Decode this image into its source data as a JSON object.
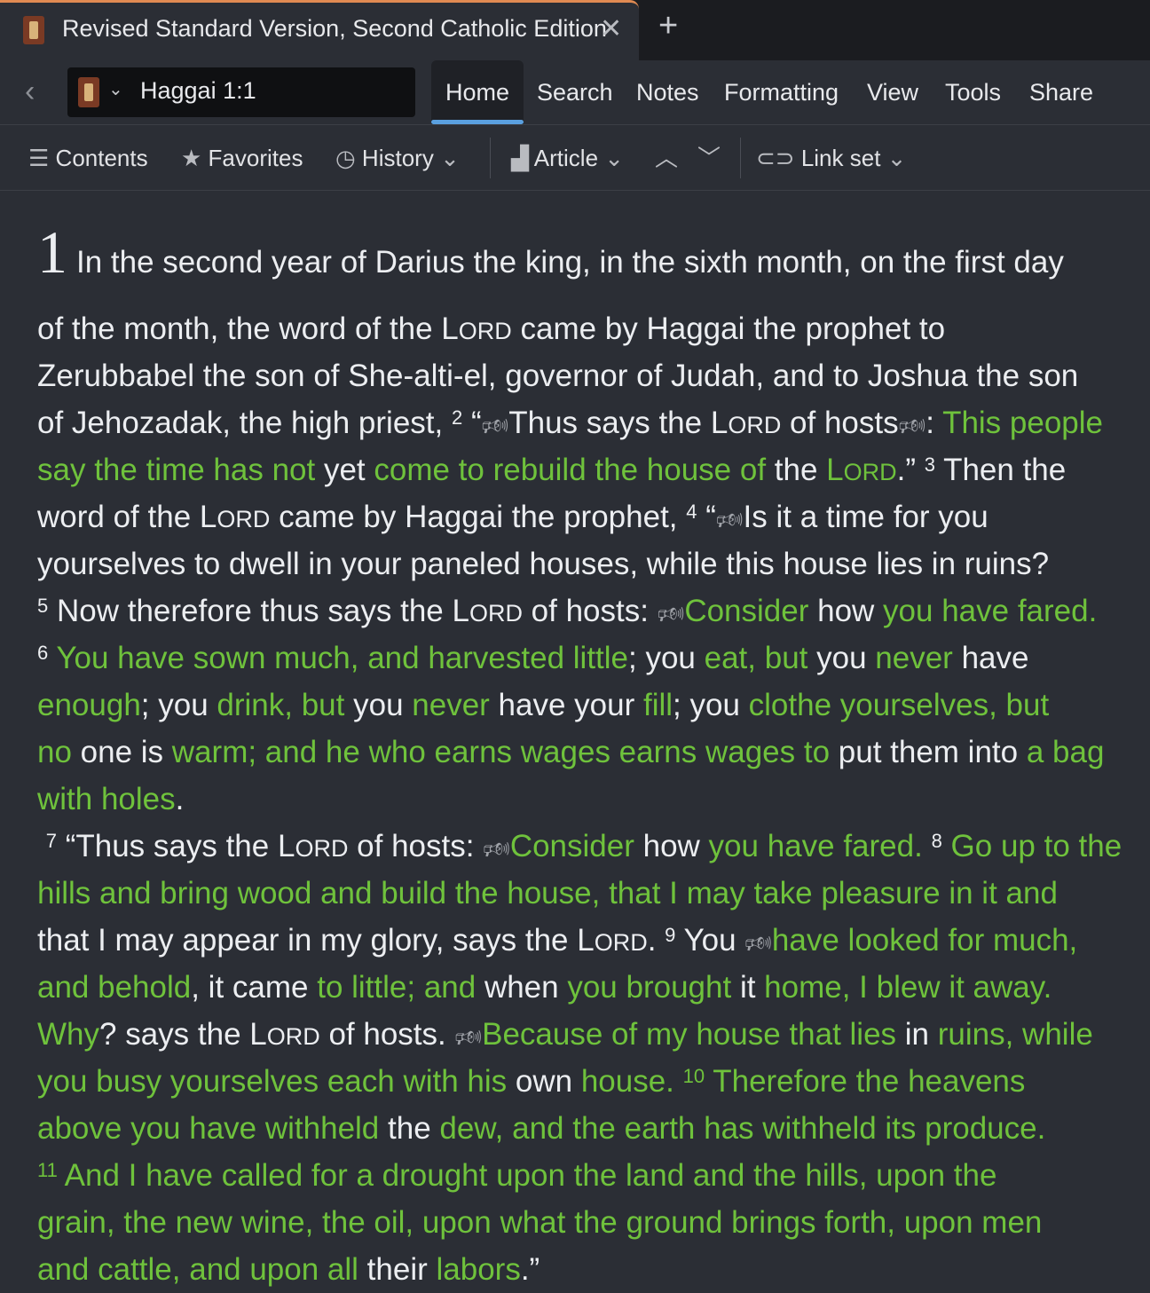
{
  "window": {
    "tab_title": "Revised Standard Version, Second Catholic Edition",
    "close_glyph": "✕",
    "add_glyph": "+"
  },
  "nav": {
    "back_glyph": "‹",
    "reference": "Haggai 1:1",
    "tabs": [
      {
        "label": "Home",
        "active": true
      },
      {
        "label": "Search"
      },
      {
        "label": "Notes"
      },
      {
        "label": "Formatting"
      },
      {
        "label": "View"
      },
      {
        "label": "Tools"
      },
      {
        "label": "Share"
      }
    ]
  },
  "toolbar": {
    "contents": "Contents",
    "favorites": "Favorites",
    "history": "History",
    "article": "Article",
    "link_set": "Link set"
  },
  "colors": {
    "background": "#2b2e35",
    "text": "#eceef1",
    "highlight_green": "#6fc23c",
    "tab_accent": "#5aa0e0",
    "tab_top_border": "#e08a52"
  },
  "text": {
    "chapter": "1",
    "marker": "🕬"
  }
}
